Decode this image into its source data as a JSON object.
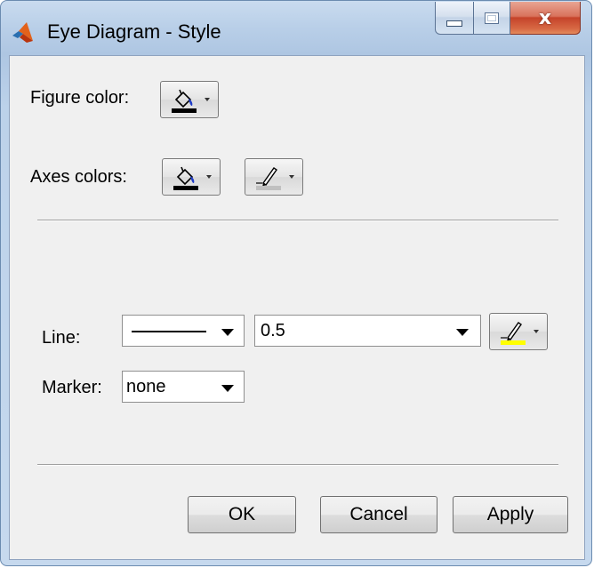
{
  "window": {
    "title": "Eye Diagram - Style"
  },
  "caption": {
    "close": "x"
  },
  "figure": {
    "label": "Figure color:"
  },
  "axes": {
    "label": "Axes colors:"
  },
  "line": {
    "label": "Line:",
    "width_value": "0.5"
  },
  "marker": {
    "label": "Marker:",
    "value": "none"
  },
  "buttons": {
    "ok": "OK",
    "cancel": "Cancel",
    "apply": "Apply"
  },
  "colors": {
    "fill_black": "#000000",
    "axes_line_gray": "#c0c0c0",
    "line_color_yellow": "#ffff00",
    "paint_bucket_blue": "#1e3cc8"
  }
}
